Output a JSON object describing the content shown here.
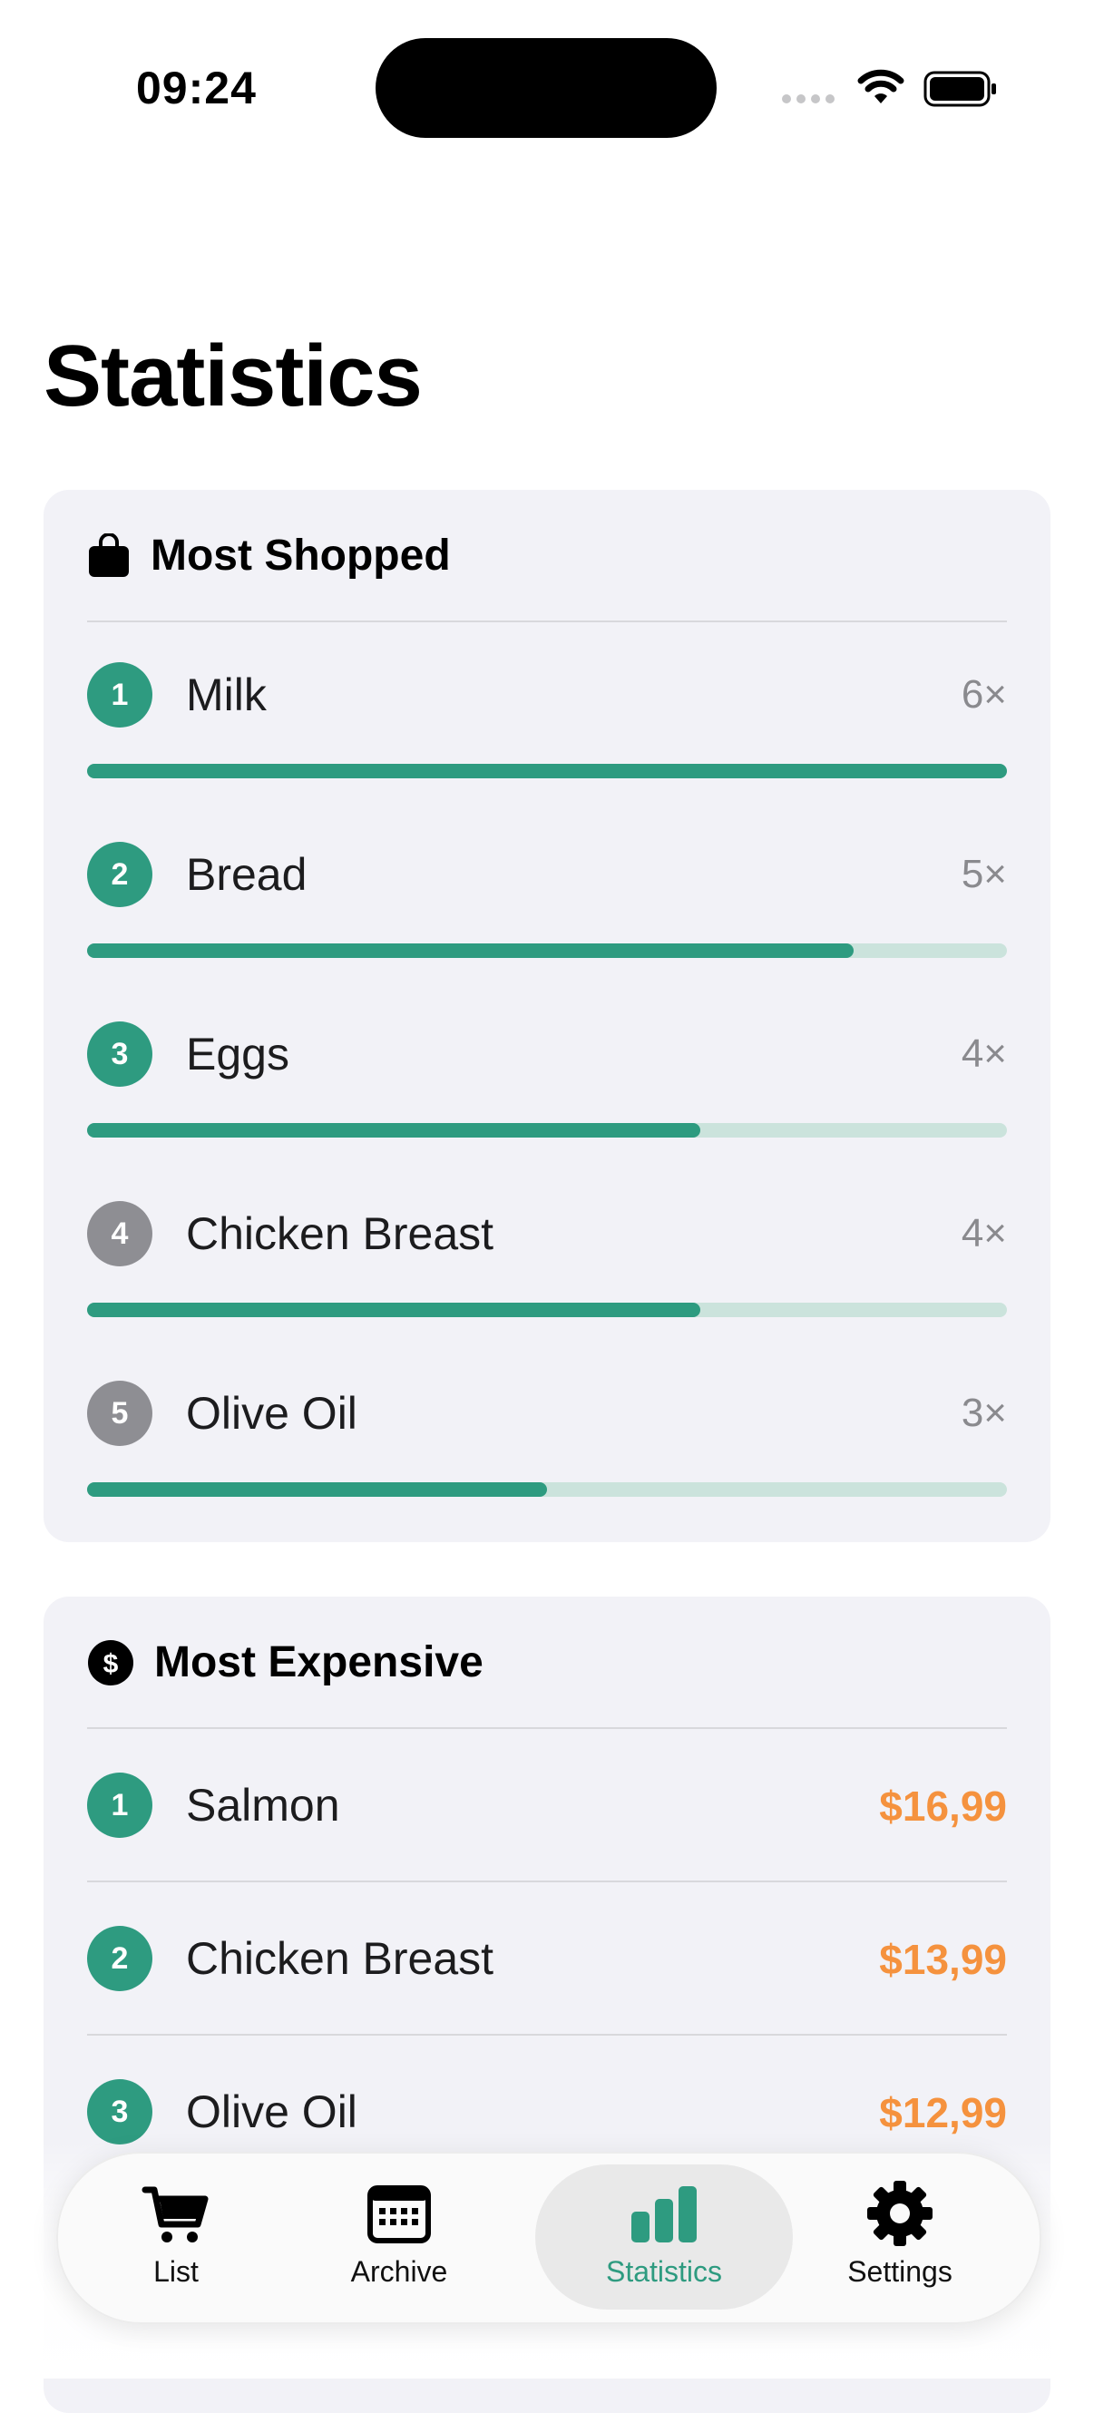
{
  "status_bar": {
    "time": "09:24"
  },
  "page": {
    "title": "Statistics"
  },
  "most_shopped": {
    "title": "Most Shopped",
    "icon": "shopping-bag-icon",
    "items": [
      {
        "rank": "1",
        "name": "Milk",
        "count": "6×",
        "fraction": 1.0,
        "rank_color": "green"
      },
      {
        "rank": "2",
        "name": "Bread",
        "count": "5×",
        "fraction": 0.833,
        "rank_color": "green"
      },
      {
        "rank": "3",
        "name": "Eggs",
        "count": "4×",
        "fraction": 0.667,
        "rank_color": "green"
      },
      {
        "rank": "4",
        "name": "Chicken Breast",
        "count": "4×",
        "fraction": 0.667,
        "rank_color": "gray"
      },
      {
        "rank": "5",
        "name": "Olive Oil",
        "count": "3×",
        "fraction": 0.5,
        "rank_color": "gray"
      }
    ]
  },
  "most_expensive": {
    "title": "Most Expensive",
    "icon": "dollar-circle-icon",
    "items": [
      {
        "rank": "1",
        "name": "Salmon",
        "price": "$16,99"
      },
      {
        "rank": "2",
        "name": "Chicken Breast",
        "price": "$13,99"
      },
      {
        "rank": "3",
        "name": "Olive Oil",
        "price": "$12,99"
      }
    ]
  },
  "tabbar": {
    "tabs": [
      {
        "label": "List",
        "icon": "cart-icon"
      },
      {
        "label": "Archive",
        "icon": "calendar-icon"
      },
      {
        "label": "Statistics",
        "icon": "bar-chart-icon",
        "active": true
      },
      {
        "label": "Settings",
        "icon": "gear-icon"
      }
    ]
  },
  "colors": {
    "accent": "#2e9b80",
    "price": "#f5923e",
    "card": "#f2f2f7",
    "bar_track": "#cbe3dc"
  }
}
